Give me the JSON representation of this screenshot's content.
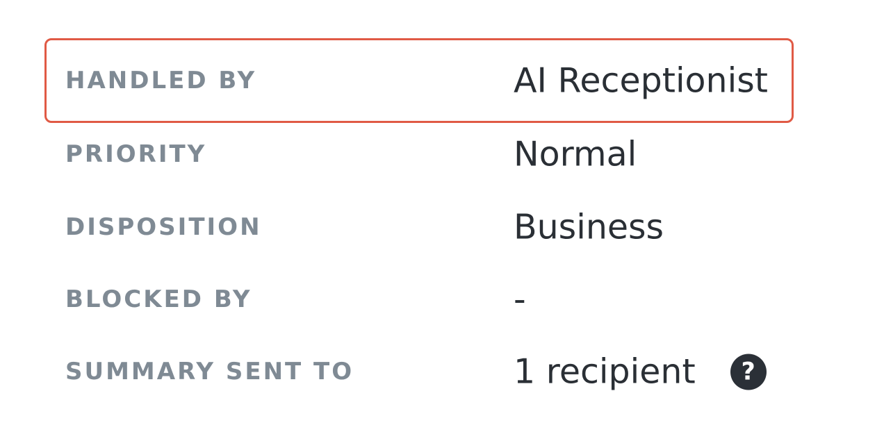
{
  "details": {
    "rows": [
      {
        "label": "HANDLED BY",
        "value": "AI Receptionist"
      },
      {
        "label": "PRIORITY",
        "value": "Normal"
      },
      {
        "label": "DISPOSITION",
        "value": "Business"
      },
      {
        "label": "BLOCKED BY",
        "value": "-"
      },
      {
        "label": "SUMMARY SENT TO",
        "value": "1 recipient"
      }
    ],
    "help_icon_glyph": "?",
    "highlight_color": "#e05a45",
    "label_color": "#7f8a94",
    "value_color": "#2a2f35"
  }
}
